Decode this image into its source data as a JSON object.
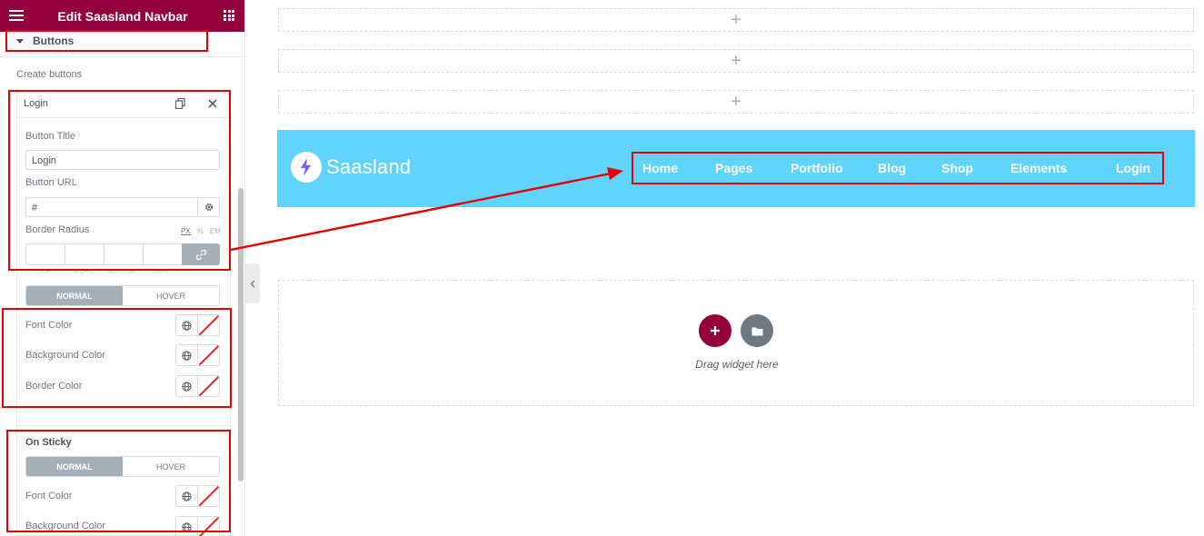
{
  "panel": {
    "header_title": "Edit Saasland Navbar",
    "section_title": "Buttons",
    "create_label": "Create buttons",
    "item_title": "Login",
    "button_title_label": "Button Title",
    "button_title_value": "Login",
    "button_url_label": "Button URL",
    "button_url_value": "#",
    "border_radius_label": "Border Radius",
    "units": [
      "PX",
      "%",
      "EM"
    ],
    "dims": [
      "TOP",
      "RIGHT",
      "BOTTOM",
      "LEFT"
    ],
    "tabs": [
      "NORMAL",
      "HOVER"
    ],
    "color_fields": [
      "Font Color",
      "Background Color",
      "Border Color"
    ],
    "sticky_title": "On Sticky",
    "sticky_tabs": [
      "NORMAL",
      "HOVER"
    ],
    "sticky_color_fields": [
      "Font Color",
      "Background Color"
    ]
  },
  "canvas": {
    "logo_text": "Saasland",
    "nav_items": [
      "Home",
      "Pages",
      "Portfolio",
      "Blog",
      "Shop",
      "Elements",
      "Login"
    ],
    "drag_text": "Drag widget here"
  },
  "colors": {
    "brand": "#93003c",
    "navbar_bg": "#60d4fc",
    "annotation": "#e60000"
  }
}
